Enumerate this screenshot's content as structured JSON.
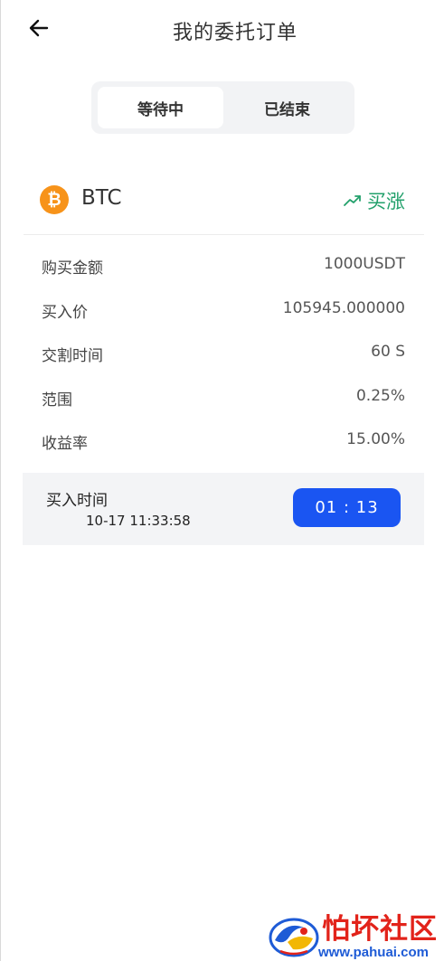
{
  "header": {
    "title": "我的委托订单",
    "back_icon": "arrow-left-icon"
  },
  "tabs": [
    {
      "label": "等待中",
      "active": true
    },
    {
      "label": "已结束",
      "active": false
    }
  ],
  "order": {
    "coin": {
      "symbol": "BTC",
      "icon_glyph": "₿",
      "icon_color": "#f7931a"
    },
    "direction": {
      "label": "买涨",
      "icon": "trending-up-icon",
      "color": "#22a06b"
    },
    "details": [
      {
        "label": "购买金额",
        "value": "1000USDT"
      },
      {
        "label": "买入价",
        "value": "105945.000000"
      },
      {
        "label": "交割时间",
        "value": "60 S"
      },
      {
        "label": "范围",
        "value": "0.25%"
      },
      {
        "label": "收益率",
        "value": "15.00%"
      }
    ],
    "buy_time": {
      "label": "买入时间",
      "value": "10-17 11:33:58"
    },
    "countdown": "01 : 13",
    "accent_color": "#1a55f2"
  },
  "watermark": {
    "title": "怕坏社区",
    "url": "www.pahuai.com"
  }
}
